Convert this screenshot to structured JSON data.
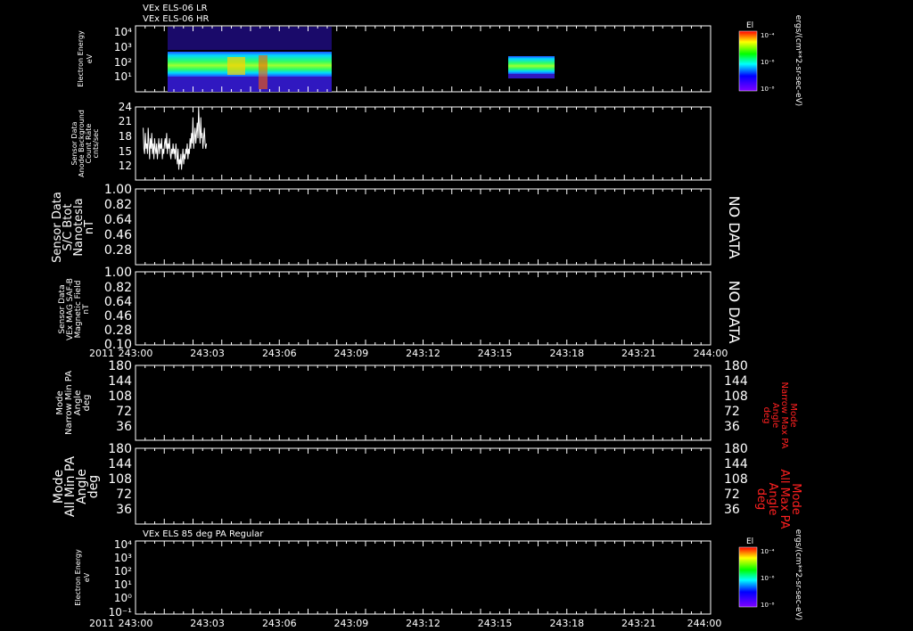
{
  "header": {
    "line1": "VEx ELS-06 LR",
    "line2": "VEx ELS-06 HR",
    "bottom_title": "VEx ELS 85 deg PA Regular"
  },
  "time_axis": {
    "year": "2011",
    "ticks": [
      "243:00",
      "243:03",
      "243:06",
      "243:09",
      "243:12",
      "243:15",
      "243:18",
      "243:21",
      "244:00"
    ]
  },
  "colorbar": {
    "title": "El",
    "unit": "ergs/(cm**2-sr-sec-eV)",
    "tick_top": "10⁻⁴",
    "tick_mid": "10⁻⁶",
    "tick_bot": "10⁻⁸"
  },
  "panels": {
    "p1": {
      "label1": "Electron Energy",
      "label2": "eV",
      "yticks": [
        "10⁴",
        "10³",
        "10²",
        "10¹"
      ]
    },
    "p2": {
      "label1": "Sensor Data",
      "label2": "Anode Background",
      "label3": "Count Rate",
      "label4": "cnts/sec",
      "yticks": [
        "24",
        "21",
        "18",
        "15",
        "12"
      ]
    },
    "p3": {
      "label1": "Sensor Data",
      "label2": "S/C Btot",
      "label3": "Nanotesla",
      "label4": "nT",
      "yticks": [
        "1.00",
        "0.82",
        "0.64",
        "0.46",
        "0.28"
      ],
      "nodata": "NO DATA"
    },
    "p4": {
      "label1": "Sensor Data",
      "label2": "VEx MAG SAF-B",
      "label3": "Magnetic Field",
      "label4": "nT",
      "yticks": [
        "1.00",
        "0.82",
        "0.64",
        "0.46",
        "0.28",
        "0.10"
      ],
      "nodata": "NO DATA"
    },
    "p5": {
      "label1": "Mode",
      "label2": "Narrow Min PA",
      "label3": "Angle",
      "label4": "deg",
      "r_label1": "Mode",
      "r_label2": "Narrow Max PA",
      "r_label3": "Angle",
      "r_label4": "deg",
      "yticks": [
        "180",
        "144",
        "108",
        "72",
        "36"
      ]
    },
    "p6": {
      "label1": "Mode",
      "label2": "All Min PA",
      "label3": "Angle",
      "label4": "deg",
      "r_label1": "Mode",
      "r_label2": "All Max PA",
      "r_label3": "Angle",
      "r_label4": "deg",
      "yticks": [
        "180",
        "144",
        "108",
        "72",
        "36"
      ]
    },
    "p7": {
      "label1": "Electron Energy",
      "label2": "eV",
      "yticks": [
        "10⁴",
        "10³",
        "10²",
        "10¹",
        "10⁰",
        "10⁻¹"
      ]
    }
  },
  "chart_data": [
    {
      "type": "heatmap",
      "title": "VEx ELS-06 LR / VEx ELS-06 HR",
      "ylabel": "Electron Energy eV",
      "yscale": "log",
      "segments": [
        {
          "t_start": "243:00.8",
          "t_end": "243:07.3",
          "band_low": 10,
          "band_high": 300,
          "peak_energy": 60
        },
        {
          "t_start": "243:15.5",
          "t_end": "243:16.8",
          "band_low": 10,
          "band_high": 200,
          "peak_energy": 60
        }
      ]
    },
    {
      "type": "line",
      "ylabel": "cnts/sec",
      "ylim": [
        10,
        24
      ],
      "x_start_min": 0.8,
      "x_end_min": 7.4,
      "values": [
        20,
        16,
        15,
        19,
        16,
        17,
        15,
        20,
        17,
        14,
        18,
        16,
        19,
        15,
        17,
        14,
        18,
        16,
        15,
        17,
        14,
        16,
        18,
        15,
        17,
        16,
        18,
        14,
        16,
        15,
        17,
        18,
        16,
        19,
        15,
        17,
        16,
        18,
        15,
        14,
        16,
        15,
        17,
        15,
        16,
        14,
        17,
        15,
        13,
        16,
        12,
        14,
        13,
        15,
        12,
        14,
        16,
        13,
        15,
        14,
        16,
        15,
        17,
        14,
        16,
        15,
        18,
        16,
        19,
        17,
        22,
        16,
        18,
        20,
        17,
        19,
        21,
        18,
        24,
        20,
        17,
        22,
        18,
        19,
        16,
        18,
        20,
        17,
        16,
        17
      ]
    },
    {
      "type": "line",
      "ylabel": "nT",
      "ylim": [
        0.1,
        1.0
      ],
      "values": []
    },
    {
      "type": "line",
      "ylabel": "nT",
      "ylim": [
        0.1,
        1.0
      ],
      "values": []
    },
    {
      "type": "line",
      "ylabel": "deg",
      "ylim": [
        0,
        180
      ],
      "values": []
    },
    {
      "type": "line",
      "ylabel": "deg",
      "ylim": [
        0,
        180
      ],
      "values": []
    },
    {
      "type": "heatmap",
      "title": "VEx ELS 85 deg PA Regular",
      "ylabel": "Electron Energy eV",
      "yscale": "log",
      "segments": []
    }
  ]
}
